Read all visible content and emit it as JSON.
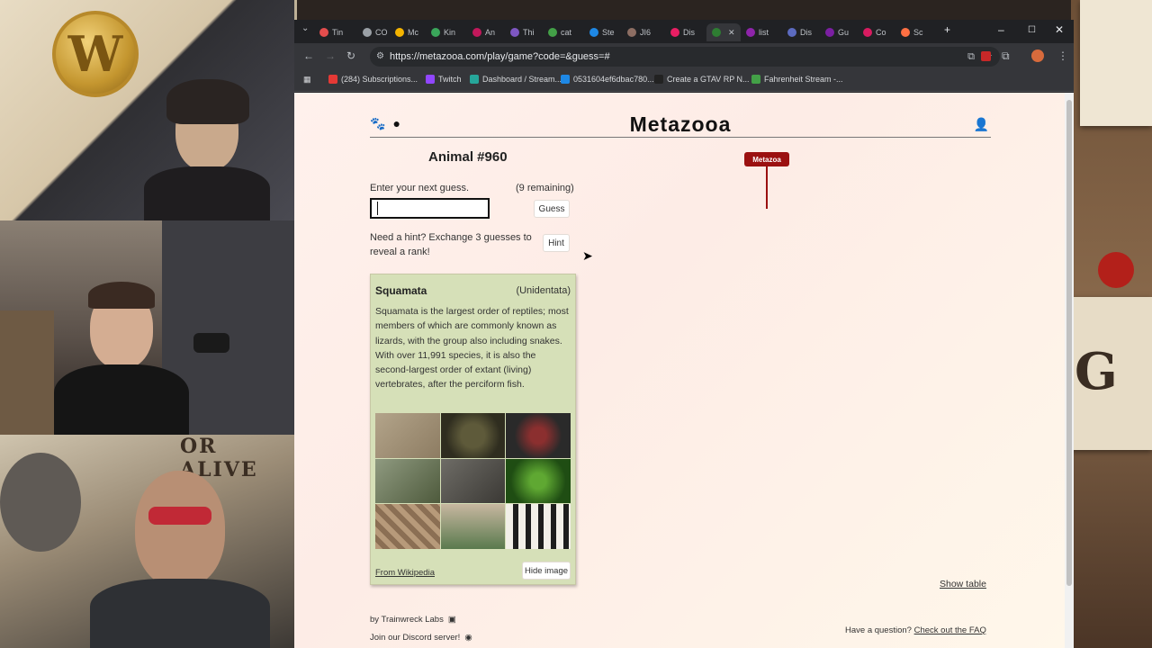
{
  "browser": {
    "url": "https://metazooa.com/play/game?code=&guess=#",
    "tabs": [
      {
        "label": "Tin",
        "color": "#e44d4d"
      },
      {
        "label": "CO",
        "color": "#9aa0a6"
      },
      {
        "label": "Mc",
        "color": "#f4b400"
      },
      {
        "label": "Kin",
        "color": "#3aa65a"
      },
      {
        "label": "An",
        "color": "#c2185b"
      },
      {
        "label": "Thi",
        "color": "#7e57c2"
      },
      {
        "label": "cat",
        "color": "#43a047"
      },
      {
        "label": "Ste",
        "color": "#1e88e5"
      },
      {
        "label": "JI6",
        "color": "#8d6e63"
      },
      {
        "label": "Dis",
        "color": "#e91e63"
      },
      {
        "label": "",
        "color": "#2e7d32"
      },
      {
        "label": "list",
        "color": "#8e24aa"
      },
      {
        "label": "Dis",
        "color": "#5c6bc0"
      },
      {
        "label": "Gu",
        "color": "#7b1fa2"
      },
      {
        "label": "Co",
        "color": "#d81b60"
      },
      {
        "label": "Sc",
        "color": "#ff7043"
      }
    ],
    "bookmarks": [
      {
        "label": "(284) Subscriptions...",
        "color": "#e53935"
      },
      {
        "label": "Twitch",
        "color": "#9146ff"
      },
      {
        "label": "Dashboard / Stream...",
        "color": "#26a69a"
      },
      {
        "label": "0531604ef6dbac780...",
        "color": "#1e88e5"
      },
      {
        "label": "Create a GTAV RP N...",
        "color": "#222222"
      },
      {
        "label": "Fahrenheit Stream -...",
        "color": "#43a047"
      }
    ]
  },
  "site": {
    "title": "Metazooa",
    "animal_number": "Animal #960",
    "guess_prompt": "Enter your next guess.",
    "remaining": "(9 remaining)",
    "guess_input_value": "",
    "guess_button": "Guess",
    "hint_prompt": "Need a hint? Exchange 3 guesses to reveal a rank!",
    "hint_button": "Hint",
    "card": {
      "title": "Squamata",
      "rank": "(Unidentata)",
      "description": "Squamata is the largest order of reptiles; most members of which are commonly known as lizards, with the group also including snakes. With over 11,991 species, it is also the second-largest order of extant (living) vertebrates, after the perciform fish.",
      "source_link": "From Wikipedia",
      "hide_button": "Hide image"
    },
    "tree_root": "Metazoa",
    "show_table": "Show table",
    "footer_by": "by Trainwreck Labs",
    "footer_discord": "Join our Discord server!",
    "faq_question": "Have a question?",
    "faq_link": "Check out the FAQ"
  },
  "colors": {
    "accent": "#9b1010",
    "card_bg": "#d6e0b8"
  }
}
